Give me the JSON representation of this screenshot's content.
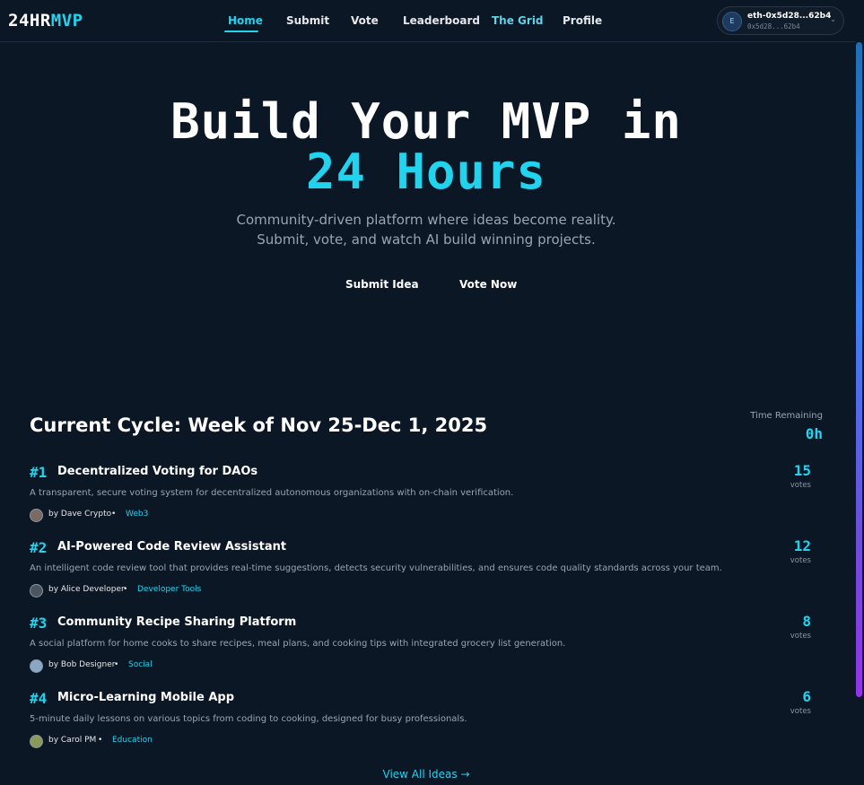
{
  "brand": {
    "part1": "24HR",
    "part2": "MVP"
  },
  "nav": {
    "items": [
      {
        "label": "Home"
      },
      {
        "label": "Submit"
      },
      {
        "label": "Vote"
      },
      {
        "label": "Leaderboard"
      },
      {
        "label": "The Grid"
      },
      {
        "label": "Profile"
      }
    ]
  },
  "wallet": {
    "avatar_letter": "E",
    "name": "eth-0x5d28...62b4",
    "address": "0x5d28...62b4"
  },
  "hero": {
    "line1": "Build Your MVP in",
    "line2": "24 Hours",
    "subtitle_1": "Community-driven platform where ideas become reality.",
    "subtitle_2": "Submit, vote, and watch AI build winning projects.",
    "submit_button": "Submit Idea",
    "vote_button": "Vote Now"
  },
  "cycle": {
    "title": "Current Cycle: Week of Nov 25-Dec 1, 2025",
    "time_label": "Time Remaining",
    "time_value": "0h"
  },
  "ideas": [
    {
      "rank": "#1",
      "title": "Decentralized Voting for DAOs",
      "description": "A transparent, secure voting system for decentralized autonomous organizations with on-chain verification.",
      "author": "by Dave Crypto",
      "tag": "Web3",
      "votes": "15",
      "votes_label": "votes"
    },
    {
      "rank": "#2",
      "title": "AI-Powered Code Review Assistant",
      "description": "An intelligent code review tool that provides real-time suggestions, detects security vulnerabilities, and ensures code quality standards across your team.",
      "author": "by Alice Developer",
      "tag": "Developer Tools",
      "votes": "12",
      "votes_label": "votes"
    },
    {
      "rank": "#3",
      "title": "Community Recipe Sharing Platform",
      "description": "A social platform for home cooks to share recipes, meal plans, and cooking tips with integrated grocery list generation.",
      "author": "by Bob Designer",
      "tag": "Social",
      "votes": "8",
      "votes_label": "votes"
    },
    {
      "rank": "#4",
      "title": "Micro-Learning Mobile App",
      "description": "5-minute daily lessons on various topics from coding to cooking, designed for busy professionals.",
      "author": "by Carol PM",
      "tag": "Education",
      "votes": "6",
      "votes_label": "votes"
    }
  ],
  "view_all": "View All Ideas →",
  "colors": {
    "background": "#0c1726",
    "accent": "#22d3ee",
    "muted_text": "#9aa4b2"
  }
}
